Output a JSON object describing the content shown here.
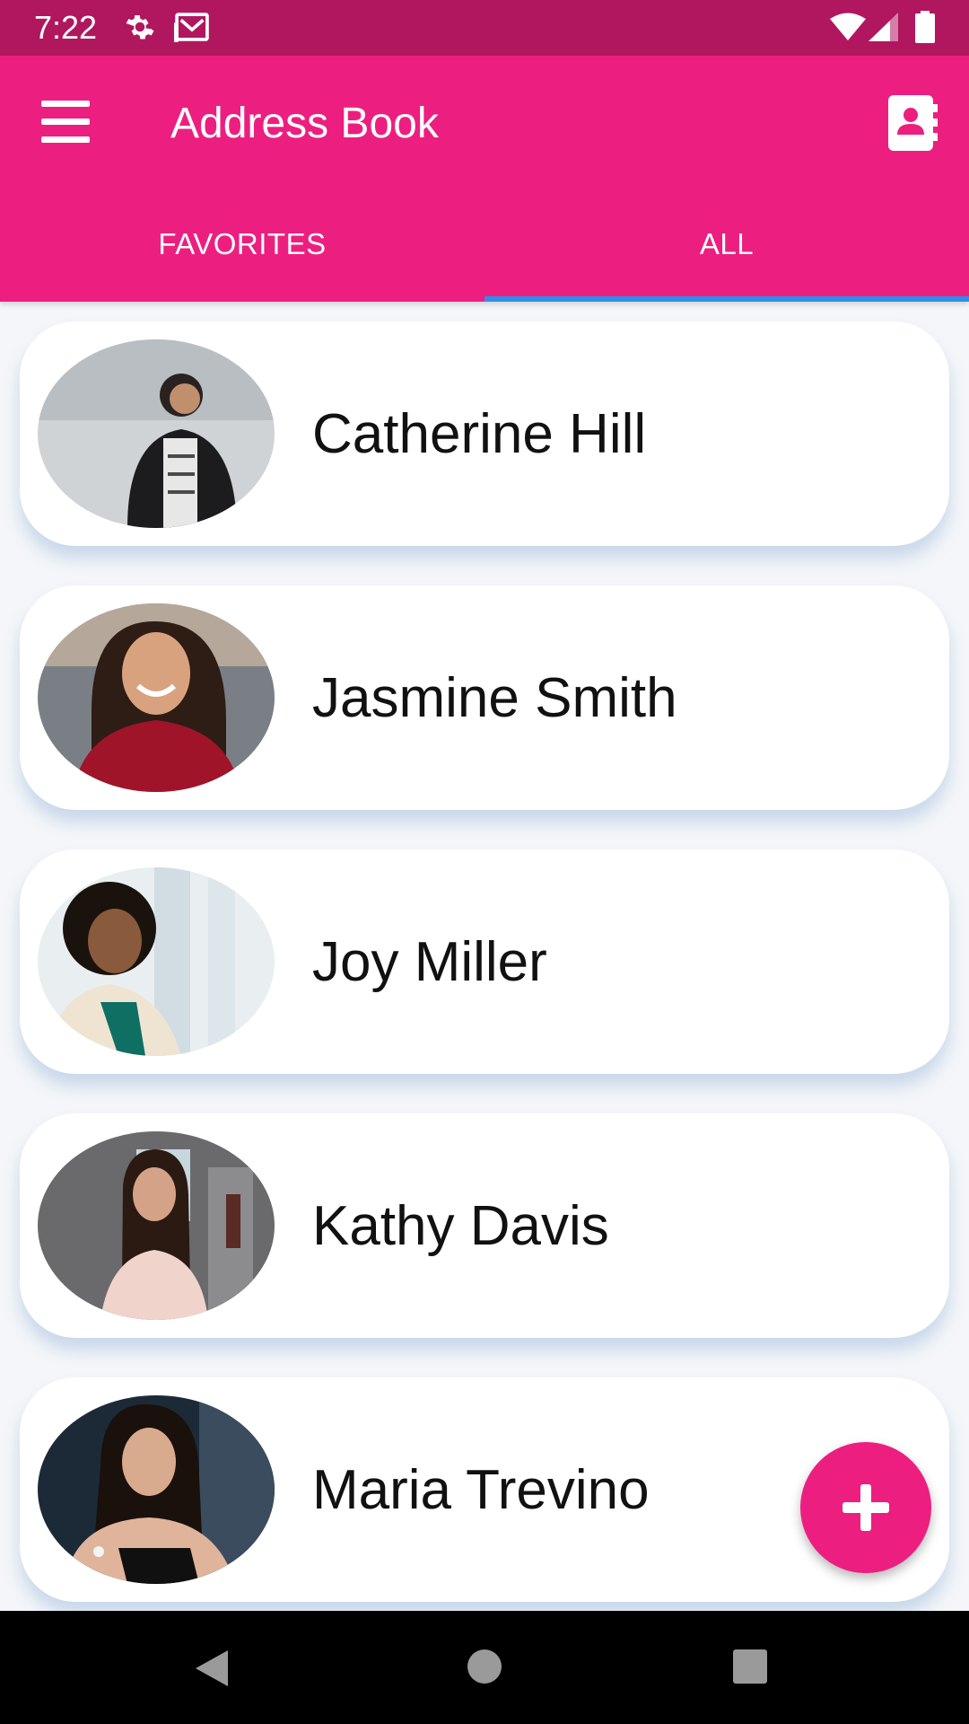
{
  "status_bar": {
    "time": "7:22",
    "icons": [
      "gear-icon",
      "mail-icon",
      "wifi-icon",
      "signal-icon",
      "battery-icon"
    ]
  },
  "app_bar": {
    "title": "Address Book",
    "menu_icon": "menu-icon",
    "contact_icon": "contact-book-icon",
    "color": "#ec1f80"
  },
  "tabs": [
    {
      "label": "FAVORITES",
      "selected": false
    },
    {
      "label": "ALL",
      "selected": true
    }
  ],
  "contacts": [
    {
      "name": "Catherine Hill"
    },
    {
      "name": "Jasmine Smith"
    },
    {
      "name": "Joy Miller"
    },
    {
      "name": "Kathy Davis"
    },
    {
      "name": "Maria Trevino"
    }
  ],
  "fab": {
    "icon": "plus-icon"
  },
  "nav_bar": {
    "icons": [
      "back-icon",
      "home-icon",
      "recents-icon"
    ]
  },
  "colors": {
    "status_bar": "#b0175f",
    "accent": "#ec1f80",
    "tab_indicator": "#2f8ee8"
  }
}
